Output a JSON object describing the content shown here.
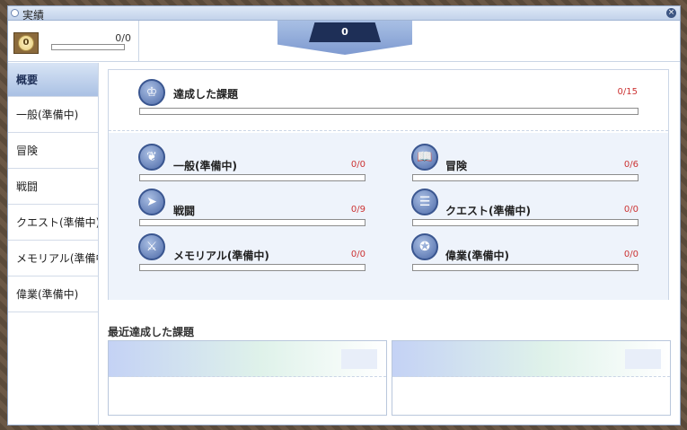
{
  "window": {
    "title": "実績"
  },
  "header": {
    "level_badge": "0",
    "level_count": "0/0",
    "points": "0"
  },
  "sidebar": {
    "items": [
      {
        "label": "概要",
        "active": true
      },
      {
        "label": "一般(準備中)",
        "active": false
      },
      {
        "label": "冒険",
        "active": false
      },
      {
        "label": "戦闘",
        "active": false
      },
      {
        "label": "クエスト(準備中)",
        "active": false
      },
      {
        "label": "メモリアル(準備中)",
        "active": false
      },
      {
        "label": "偉業(準備中)",
        "active": false
      }
    ]
  },
  "summary": {
    "total": {
      "label": "達成した課題",
      "count": "0/15",
      "icon": "trophy-icon",
      "progress": 0
    },
    "categories": [
      {
        "label": "一般(準備中)",
        "count": "0/0",
        "icon": "laurel-icon",
        "progress": 0
      },
      {
        "label": "冒険",
        "count": "0/6",
        "icon": "book-icon",
        "progress": 0
      },
      {
        "label": "戦闘",
        "count": "0/9",
        "icon": "arrow-icon",
        "progress": 0
      },
      {
        "label": "クエスト(準備中)",
        "count": "0/0",
        "icon": "scroll-icon",
        "progress": 0
      },
      {
        "label": "メモリアル(準備中)",
        "count": "0/0",
        "icon": "sword-icon",
        "progress": 0
      },
      {
        "label": "偉業(準備中)",
        "count": "0/0",
        "icon": "medal-icon",
        "progress": 0
      }
    ]
  },
  "recent": {
    "title": "最近達成した課題"
  },
  "colors": {
    "accent": "#4d6aa8",
    "count_red": "#cc3333",
    "panel_bg": "#eef3fb"
  }
}
